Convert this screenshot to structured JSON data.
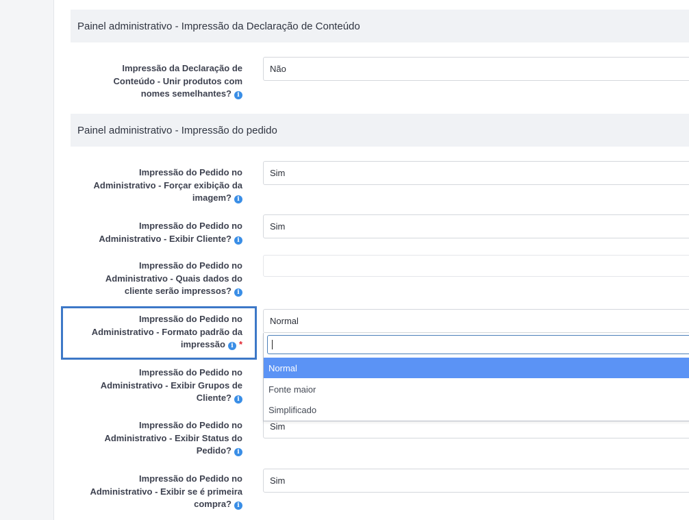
{
  "sections": [
    {
      "title": "Painel administrativo - Impressão da Declaração de Conteúdo"
    },
    {
      "title": "Painel administrativo - Impressão do pedido"
    }
  ],
  "fields": [
    {
      "label_lines": [
        "Impressão da Declaração de",
        "Conteúdo - Unir produtos com",
        "nomes semelhantes?"
      ],
      "value": "Não"
    },
    {
      "label_lines": [
        "Impressão do Pedido no",
        "Administrativo - Forçar exibição da",
        "imagem?"
      ],
      "value": "Sim"
    },
    {
      "label_lines": [
        "Impressão do Pedido no",
        "Administrativo - Exibir Cliente?"
      ],
      "value": "Sim"
    },
    {
      "label_lines": [
        "Impressão do Pedido no",
        "Administrativo - Quais dados do",
        "cliente serão impressos?"
      ],
      "value": ""
    },
    {
      "label_lines": [
        "Impressão do Pedido no",
        "Administrativo - Formato padrão da",
        "impressão"
      ],
      "value": "Normal",
      "required_mark": "*"
    },
    {
      "label_lines": [
        "Impressão do Pedido no",
        "Administrativo - Exibir Grupos de",
        "Cliente?"
      ],
      "value": ""
    },
    {
      "label_lines": [
        "Impressão do Pedido no",
        "Administrativo - Exibir Status do",
        "Pedido?"
      ],
      "value": "Sim"
    },
    {
      "label_lines": [
        "Impressão do Pedido no",
        "Administrativo - Exibir se é primeira",
        "compra?"
      ],
      "value": "Sim"
    }
  ],
  "info_icon_glyph": "i",
  "info_icon_color": "#3a8ee6",
  "highlight_color": "#3d78c7",
  "dropdown": {
    "search_value": "",
    "options": [
      "Normal",
      "Fonte maior",
      "Simplificado"
    ],
    "selected_index": 0,
    "selected_color": "#5b93f5"
  }
}
